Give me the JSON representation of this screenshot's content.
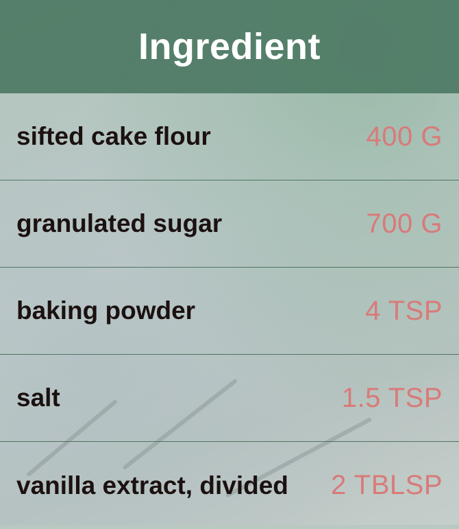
{
  "header": {
    "title": "Ingredient"
  },
  "ingredients": [
    {
      "name": "sifted cake flour",
      "amount": "400 G"
    },
    {
      "name": "granulated sugar",
      "amount": "700 G"
    },
    {
      "name": "baking powder",
      "amount": "4 TSP"
    },
    {
      "name": "salt",
      "amount": "1.5 TSP"
    },
    {
      "name": "vanilla extract, divided",
      "amount": "2 TBLSP"
    }
  ],
  "colors": {
    "header_bg": "#4e7a64",
    "ingredient_text": "#1b1110",
    "amount_text": "#d97a78",
    "divider": "#4e7560"
  }
}
